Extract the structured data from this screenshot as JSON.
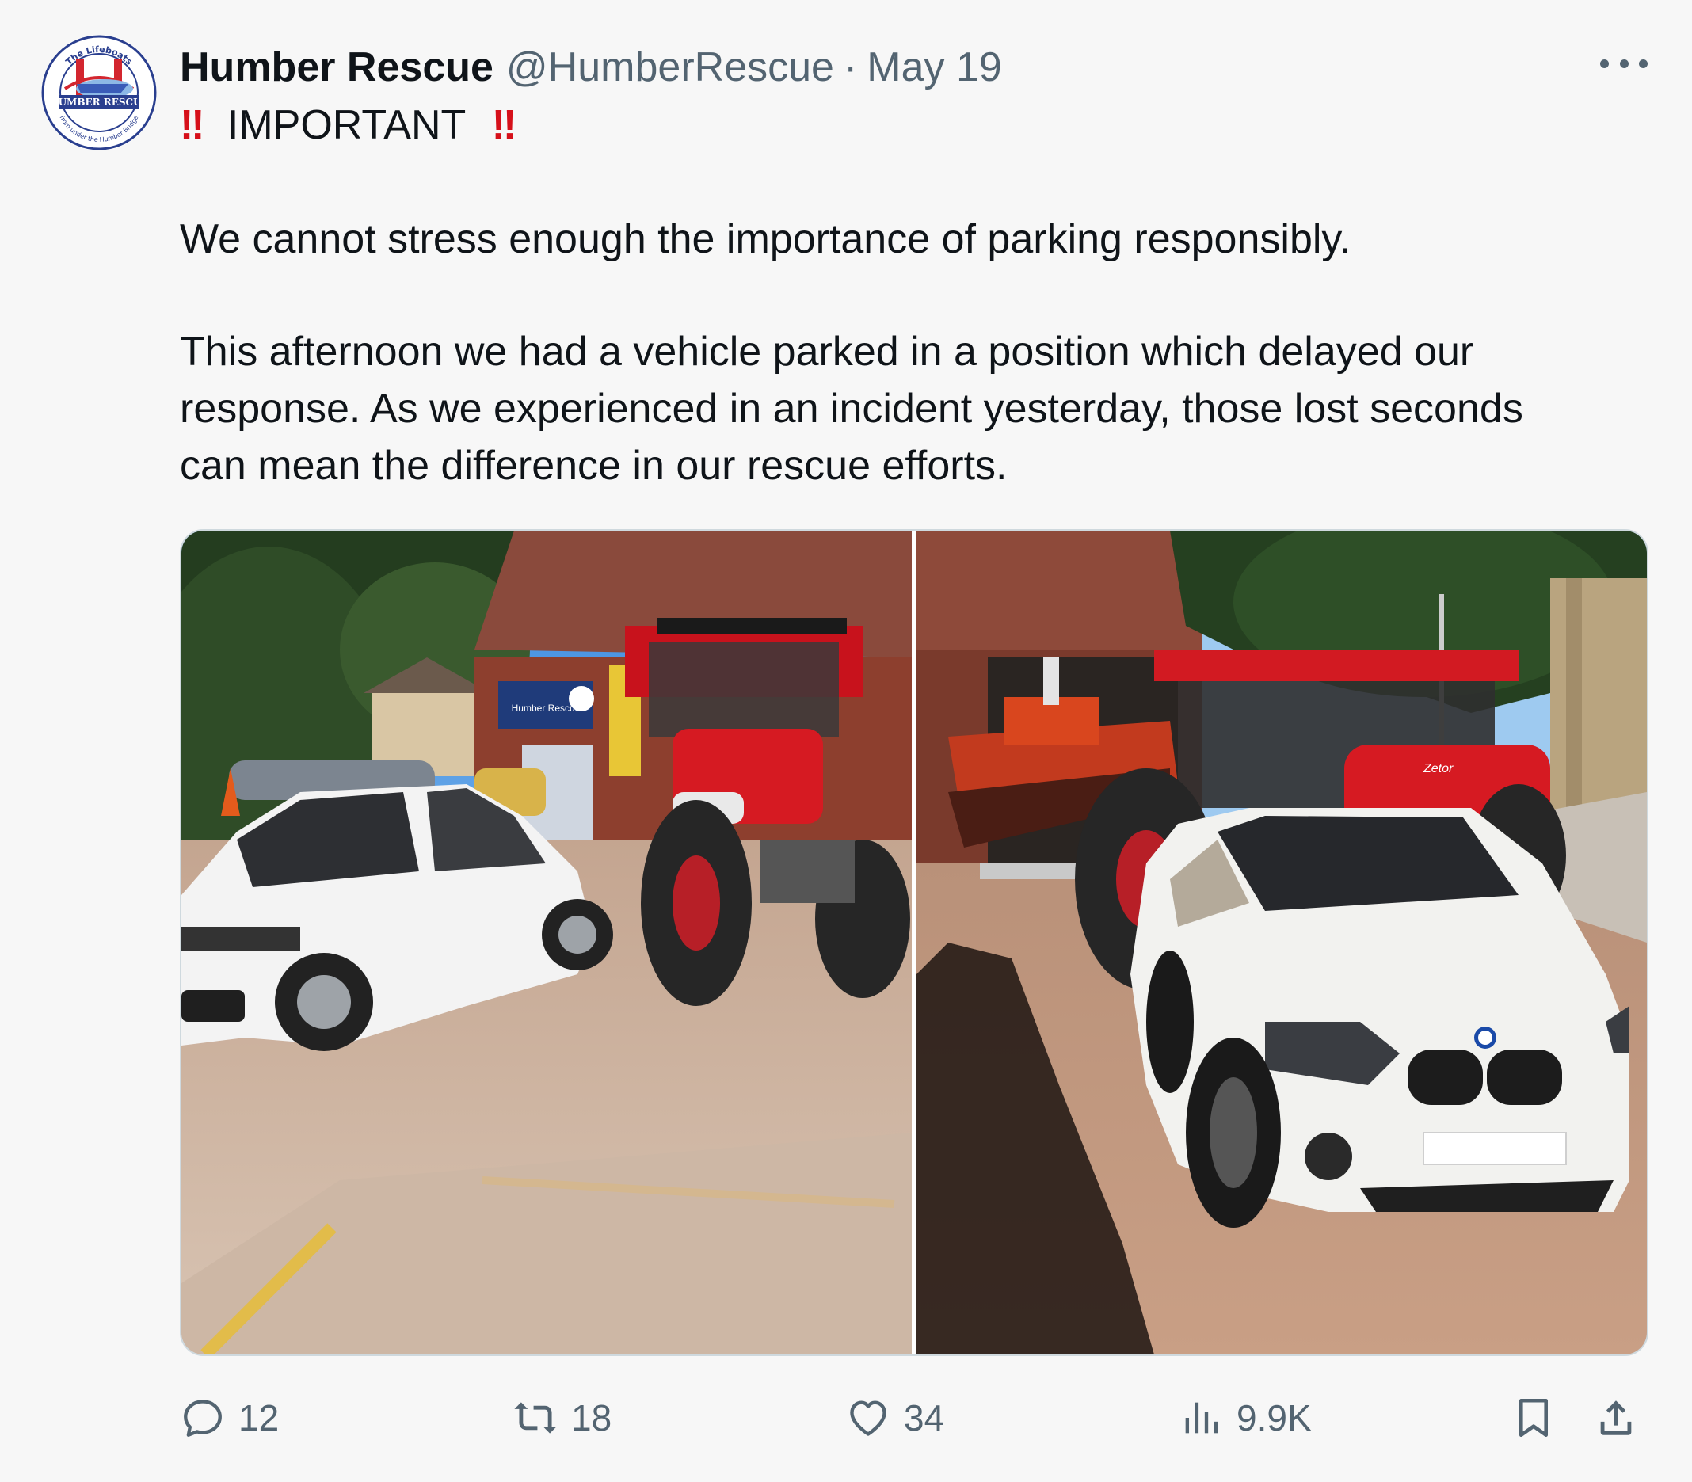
{
  "author": {
    "display_name": "Humber Rescue",
    "handle": "@HumberRescue",
    "separator": "·",
    "date": "May 19",
    "avatar": {
      "top_text": "The Lifeboats",
      "banner_text": "HUMBER RESCUE",
      "bottom_text": "from under the Humber Bridge"
    }
  },
  "tweet": {
    "headline": "IMPORTANT",
    "emphasis_glyph": "‼",
    "paragraph_1": "We cannot stress enough the importance of parking responsibly.",
    "paragraph_2_line_1": "This afternoon we had a vehicle parked in a position which delayed our",
    "paragraph_2_line_2": "response. As we experienced in an incident yesterday, those lost seconds",
    "paragraph_2_line_3": "can mean the difference in our rescue efforts."
  },
  "media": {
    "sign_text": "Humber Rescue",
    "tractor_brand": "Zetor"
  },
  "actions": {
    "replies": "12",
    "reposts": "18",
    "likes": "34",
    "views": "9.9K"
  },
  "icons": [
    "more-icon",
    "reply-icon",
    "repost-icon",
    "like-icon",
    "views-icon",
    "bookmark-icon",
    "share-icon"
  ],
  "colors": {
    "emphasis_red": "#d6101a",
    "text_secondary": "#536471",
    "text_primary": "#0f1419"
  }
}
